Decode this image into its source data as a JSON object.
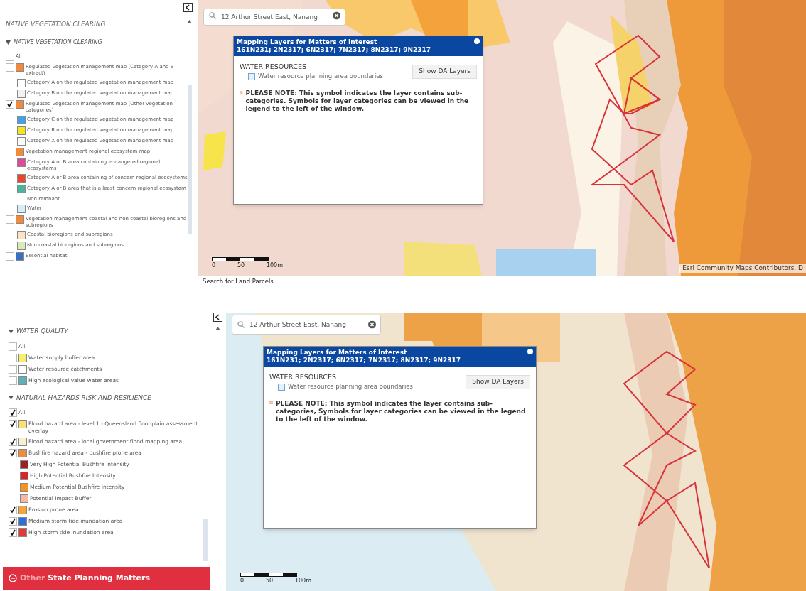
{
  "panes": [
    {
      "legend": {
        "heading": "NATIVE VEGETATION CLEARING",
        "sections": [
          {
            "title": "NATIVE VEGETATION CLEARING",
            "expanded": true,
            "items": [
              {
                "kind": "checkbox",
                "checked": false,
                "label": "All"
              },
              {
                "kind": "checkbox",
                "checked": false,
                "label": "Regulated vegetation management map (Category A and B extract)",
                "color": "#f08a3c"
              },
              {
                "kind": "sub",
                "label": "Category A on the regulated vegetation management map",
                "color": "#ffffff"
              },
              {
                "kind": "sub",
                "label": "Category B on the regulated vegetation management map",
                "color": "#f2f2f2"
              },
              {
                "kind": "checkbox",
                "checked": true,
                "label": "Regulated vegetation management map (Other vegetation categories)",
                "color": "#f08a3c"
              },
              {
                "kind": "sub",
                "label": "Category C on the regulated vegetation management map",
                "color": "#4a9fe0"
              },
              {
                "kind": "sub",
                "label": "Category R on the regulated vegetation management map",
                "color": "#f5e61c"
              },
              {
                "kind": "sub",
                "label": "Category X on the regulated vegetation management map",
                "color": "#fefefe"
              },
              {
                "kind": "checkbox",
                "checked": false,
                "label": "Vegetation management regional ecosystem map",
                "color": "#f08a3c"
              },
              {
                "kind": "sub",
                "label": "Category A or B area containing endangered regional ecosystems",
                "color": "#e2479a"
              },
              {
                "kind": "sub",
                "label": "Category A or B area containing of concern regional ecosystems",
                "color": "#e8472a"
              },
              {
                "kind": "sub",
                "label": "Category A or B area that is a least concern regional ecosystem",
                "color": "#4fb39a"
              },
              {
                "kind": "sub",
                "label": "Non remnant"
              },
              {
                "kind": "sub",
                "label": "Water",
                "color": "#d8eef8"
              },
              {
                "kind": "checkbox",
                "checked": false,
                "label": "Vegetation management coastal and non coastal bioregions and subregions",
                "color": "#f08a3c"
              },
              {
                "kind": "sub",
                "label": "Coastal bioregions and subregions",
                "color": "#fbe3c4"
              },
              {
                "kind": "sub",
                "label": "Non coastal bioregions and subregions",
                "color": "#d9ecb8"
              },
              {
                "kind": "checkbox",
                "checked": false,
                "label": "Essential habitat",
                "color": "#3a6fc4"
              }
            ]
          }
        ]
      },
      "map": {
        "search_value": "12 Arthur Street East, Nanang",
        "popup": {
          "title": "Mapping Layers for Matters of Interest",
          "subtitle": "161N231; 2N2317; 6N2317; 7N2317; 8N2317; 9N2317",
          "section": "WATER RESOURCES",
          "layer": "Water resource planning area boundaries",
          "button": "Show DA Layers",
          "note": "PLEASE NOTE: This symbol indicates the layer contains sub-categories. Symbols for layer categories can be viewed in the legend to the left of the window."
        },
        "scale_labels": [
          "0",
          "50",
          "100m"
        ],
        "attribution": "Esri Community Maps Contributors, D"
      },
      "caption": "Search for Land Parcels"
    },
    {
      "legend": {
        "sections": [
          {
            "title": "WATER QUALITY",
            "expanded": true,
            "items": [
              {
                "kind": "checkbox",
                "checked": false,
                "label": "All"
              },
              {
                "kind": "checkbox",
                "checked": false,
                "label": "Water supply buffer area",
                "color": "#f7ef6a"
              },
              {
                "kind": "checkbox",
                "checked": false,
                "label": "Water resource catchments",
                "color": "#ffffff"
              },
              {
                "kind": "checkbox",
                "checked": false,
                "label": "High ecological value water areas",
                "color": "#5fb0b8"
              }
            ]
          },
          {
            "title": "NATURAL HAZARDS RISK AND RESILIENCE",
            "expanded": true,
            "items": [
              {
                "kind": "checkbox",
                "checked": true,
                "label": "All"
              },
              {
                "kind": "checkbox",
                "checked": true,
                "label": "Flood hazard area - level 1 - Queensland floodplain assessment overlay",
                "color": "#fbe07a"
              },
              {
                "kind": "checkbox",
                "checked": true,
                "label": "Flood hazard area - local government flood mapping area",
                "color": "#f4f0d0"
              },
              {
                "kind": "checkbox",
                "checked": true,
                "label": "Bushfire hazard area - bushfire prone area",
                "color": "#f08a3c"
              },
              {
                "kind": "sub",
                "label": "Very High Potential Bushfire Intensity",
                "color": "#9b2226"
              },
              {
                "kind": "sub",
                "label": "High Potential Bushfire Intensity",
                "color": "#d62828"
              },
              {
                "kind": "sub",
                "label": "Medium Potential Bushfire Intensity",
                "color": "#f7941d"
              },
              {
                "kind": "sub",
                "label": "Potential Impact Buffer",
                "color": "#f6b8a8"
              },
              {
                "kind": "checkbox",
                "checked": true,
                "label": "Erosion prone area",
                "color": "#f7a43c"
              },
              {
                "kind": "checkbox",
                "checked": true,
                "label": "Medium storm tide inundation area",
                "color": "#2f6fd6"
              },
              {
                "kind": "checkbox",
                "checked": true,
                "label": "High storm tide inundation area",
                "color": "#e53935"
              }
            ]
          }
        ]
      },
      "map": {
        "search_value": "12 Arthur Street East, Nanang",
        "popup": {
          "title": "Mapping Layers for Matters of Interest",
          "subtitle": "161N231; 2N2317; 6N2317; 7N2317; 8N2317; 9N2317",
          "section": "WATER RESOURCES",
          "layer": "Water resource planning area boundaries",
          "button": "Show DA Layers",
          "note": "PLEASE NOTE: This symbol indicates the layer contains sub-categories, Symbols for layer categories can be viewed in the legend to the left of the window."
        },
        "scale_labels": [
          "0",
          "50",
          "100m"
        ]
      },
      "footer_button": {
        "muted": "Other",
        "label": "State Planning Matters"
      }
    }
  ]
}
